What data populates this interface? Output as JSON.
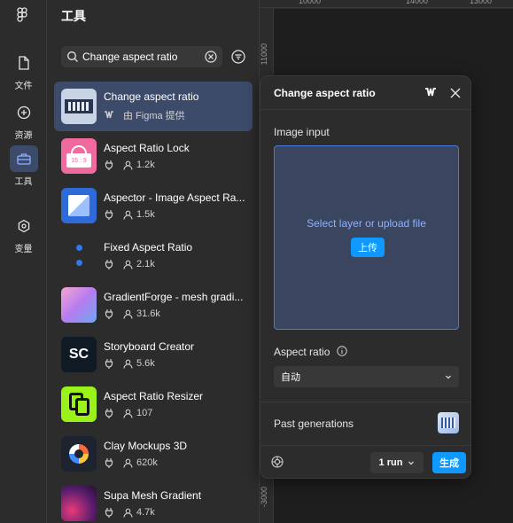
{
  "rail": {
    "items": [
      {
        "label": "文件",
        "icon": "file-icon"
      },
      {
        "label": "资源",
        "icon": "assets-icon"
      },
      {
        "label": "工具",
        "icon": "toolbox-icon",
        "active": true
      },
      {
        "label": "变量",
        "icon": "variables-icon"
      }
    ]
  },
  "panel": {
    "title": "工具",
    "search": {
      "value": "Change aspect ratio"
    }
  },
  "plugins": [
    {
      "name": "Change aspect ratio",
      "meta": "由 Figma 提供"
    },
    {
      "name": "Aspect Ratio Lock",
      "users": "1.2k",
      "thumb_text": "16 : 9"
    },
    {
      "name": "Aspector - Image Aspect Ra...",
      "users": "1.5k"
    },
    {
      "name": "Fixed Aspect Ratio",
      "users": "2.1k"
    },
    {
      "name": "GradientForge - mesh gradi...",
      "users": "31.6k"
    },
    {
      "name": "Storyboard Creator",
      "users": "5.6k",
      "thumb_text": "SC"
    },
    {
      "name": "Aspect Ratio Resizer",
      "users": "107"
    },
    {
      "name": "Clay Mockups 3D",
      "users": "620k"
    },
    {
      "name": "Supa Mesh Gradient",
      "users": "4.7k"
    }
  ],
  "rulers": {
    "top_labels": [
      "10000",
      "14000",
      "13000"
    ],
    "left_labels": [
      "11000",
      "-3000"
    ]
  },
  "modal": {
    "title": "Change aspect ratio",
    "image_input_label": "Image input",
    "drop_text": "Select layer or upload file",
    "upload_label": "上传",
    "aspect_ratio_label": "Aspect ratio",
    "aspect_ratio_value": "自动",
    "past_label": "Past generations",
    "runs_label": "1 run",
    "generate_label": "生成"
  },
  "colors": {
    "accent": "#0d99ff",
    "selected": "#3d4b6b",
    "panel": "#2c2c2c",
    "canvas": "#1e1e1e"
  }
}
